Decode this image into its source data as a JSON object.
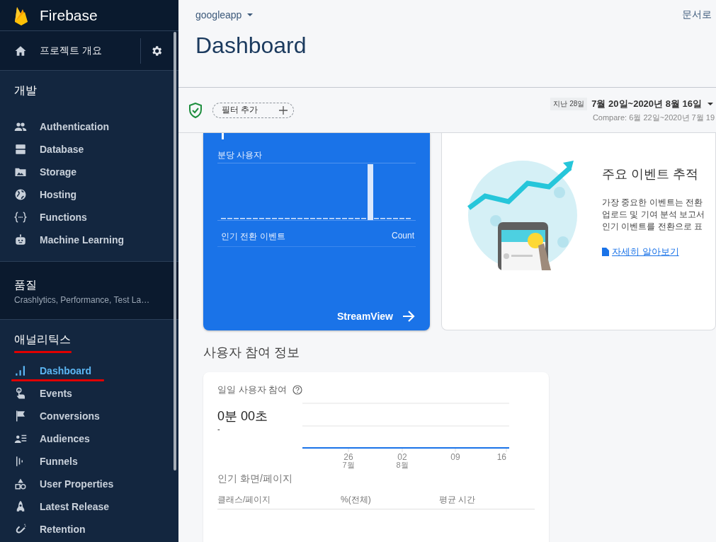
{
  "sidebar": {
    "brand": "Firebase",
    "project_overview": "프로젝트 개요",
    "develop": {
      "title": "개발",
      "items": [
        {
          "label": "Authentication",
          "selected": false
        },
        {
          "label": "Database",
          "selected": false
        },
        {
          "label": "Storage",
          "selected": false
        },
        {
          "label": "Hosting",
          "selected": false
        },
        {
          "label": "Functions",
          "selected": false
        },
        {
          "label": "Machine Learning",
          "selected": false
        }
      ]
    },
    "quality": {
      "title": "품질",
      "subtitle": "Crashlytics, Performance, Test La…"
    },
    "analytics": {
      "title": "애널리틱스",
      "underlined": true,
      "items": [
        {
          "label": "Dashboard",
          "selected": true,
          "underlined": true
        },
        {
          "label": "Events",
          "selected": false,
          "underlined": false
        },
        {
          "label": "Conversions",
          "selected": false,
          "underlined": false
        },
        {
          "label": "Audiences",
          "selected": false,
          "underlined": false
        },
        {
          "label": "Funnels",
          "selected": false,
          "underlined": false
        },
        {
          "label": "User Properties",
          "selected": false,
          "underlined": false
        },
        {
          "label": "Latest Release",
          "selected": false,
          "underlined": false
        },
        {
          "label": "Retention",
          "selected": false,
          "underlined": false
        }
      ]
    }
  },
  "header": {
    "project": "googleapp",
    "docs_link": "문서로",
    "page_title": "Dashboard"
  },
  "filter_bar": {
    "filter_chip": "필터 추가",
    "preset": "지난 28일",
    "range": "7월 20일~2020년 8월 16일",
    "compare": "Compare: 6월 22일~2020년 7월 19"
  },
  "streamview_card": {
    "chart_title": "분당 사용자",
    "table_columns": [
      "인기 전환 이벤트",
      "Count"
    ],
    "link": "StreamView"
  },
  "key_events_card": {
    "title": "주요 이벤트 추적",
    "description_lines": [
      "가장 중요한 이벤트는 전환",
      "업로드 및 기여 분석 보고서",
      "인기 이벤트를 전환으로 표"
    ],
    "link": "자세히 알아보기"
  },
  "engagement": {
    "heading": "사용자 참여 정보",
    "card": {
      "title": "일일 사용자 참여",
      "value": "0분 00초",
      "change": "-",
      "x_labels": [
        {
          "day": "26",
          "month": "7월"
        },
        {
          "day": "02",
          "month": "8월"
        },
        {
          "day": "09"
        },
        {
          "day": "16"
        }
      ],
      "section_title": "인기 화면/페이지",
      "table_columns": [
        "클래스/페이지",
        "%(전체)",
        "평균 시간"
      ]
    }
  }
}
